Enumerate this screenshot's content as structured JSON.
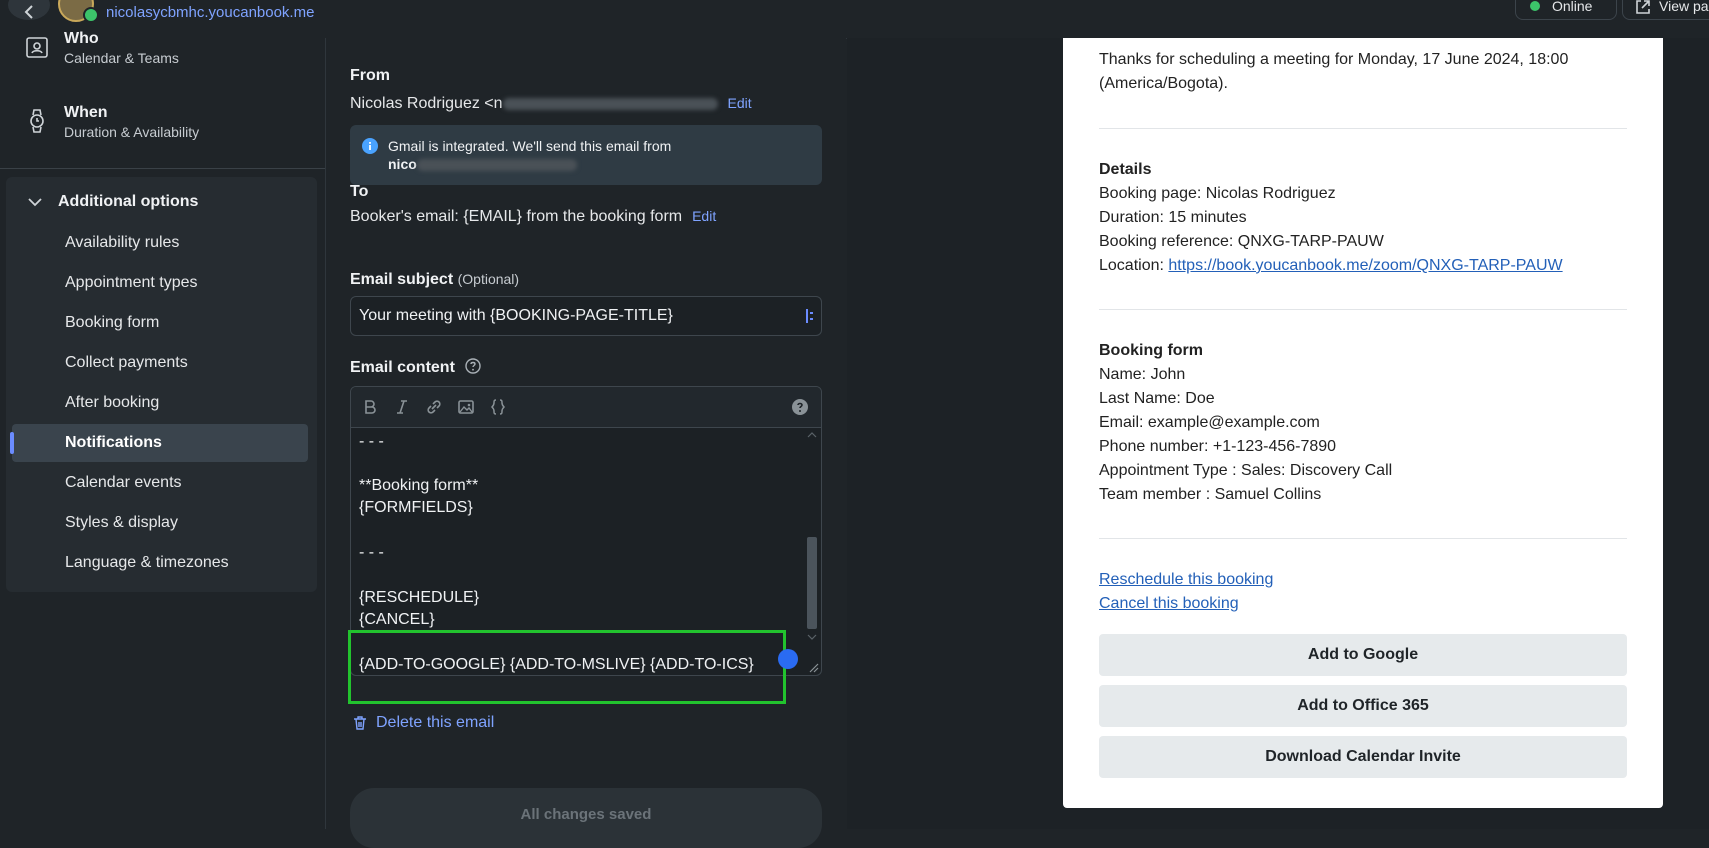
{
  "header": {
    "subdomain": "nicolasycbmhc.youcanbook.me",
    "status_label": "Online",
    "view_label": "View pa"
  },
  "sidebar": {
    "who": {
      "title": "Who",
      "subtitle": "Calendar & Teams"
    },
    "when": {
      "title": "When",
      "subtitle": "Duration & Availability"
    },
    "additional_options": {
      "title": "Additional options",
      "items": [
        {
          "label": "Availability rules"
        },
        {
          "label": "Appointment types"
        },
        {
          "label": "Booking form"
        },
        {
          "label": "Collect payments"
        },
        {
          "label": "After booking"
        },
        {
          "label": "Notifications"
        },
        {
          "label": "Calendar events"
        },
        {
          "label": "Styles & display"
        },
        {
          "label": "Language & timezones"
        }
      ],
      "active": "Notifications"
    }
  },
  "email_editor": {
    "from_label": "From",
    "from_value": "Nicolas Rodriguez <n",
    "edit_label": "Edit",
    "info_line1": "Gmail is integrated. We'll send this email from",
    "info_line2": "nico",
    "to_label": "To",
    "to_value": "Booker's email: {EMAIL} from the booking form",
    "subject_label": "Email subject",
    "subject_optional": "(Optional)",
    "subject_value": "Your meeting with {BOOKING-PAGE-TITLE}",
    "content_label": "Email content",
    "content_lines": [
      "- - -",
      "",
      "**Booking form**",
      "{FORMFIELDS}",
      "",
      "- - -",
      "",
      "{RESCHEDULE}",
      "{CANCEL}",
      "",
      "{ADD-TO-GOOGLE} {ADD-TO-MSLIVE} {ADD-TO-ICS}"
    ],
    "delete_label": "Delete this email",
    "saved_label": "All changes saved"
  },
  "preview": {
    "intro_line1": "Thanks for scheduling a meeting for Monday, 17 June 2024, 18:00",
    "intro_line2": "(America/Bogota).",
    "details_title": "Details",
    "booking_page": "Booking page: Nicolas Rodriguez",
    "duration": "Duration: 15 minutes",
    "booking_reference": "Booking reference: QNXG-TARP-PAUW",
    "location_label": "Location: ",
    "location_url": "https://book.youcanbook.me/zoom/QNXG-TARP-PAUW",
    "form_title": "Booking form",
    "form_fields": [
      "Name: John",
      "Last Name: Doe",
      "Email: example@example.com",
      "Phone number: +1-123-456-7890",
      "Appointment Type : Sales: Discovery Call",
      "Team member : Samuel Collins"
    ],
    "reschedule_link": "Reschedule this booking",
    "cancel_link": "Cancel this booking",
    "buttons": {
      "google": "Add to Google",
      "office": "Add to Office 365",
      "ics": "Download Calendar Invite"
    }
  }
}
